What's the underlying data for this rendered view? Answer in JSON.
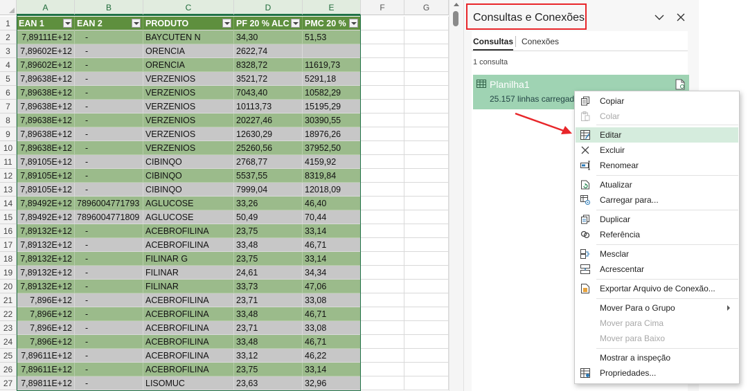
{
  "sheet": {
    "columns": [
      "A",
      "B",
      "C",
      "D",
      "E",
      "F",
      "G"
    ],
    "table_headers": [
      "EAN 1",
      "EAN 2",
      "PRODUTO",
      "PF 20 %  ALC",
      "PMC 20 %"
    ],
    "rows": [
      {
        "n": "2",
        "a": "7,89111E+12",
        "b": "-",
        "c": "BAYCUTEN N",
        "d": "34,30",
        "e": "51,53"
      },
      {
        "n": "3",
        "a": "7,89602E+12",
        "b": "-",
        "c": "ORENCIA",
        "d": "2622,74",
        "e": ""
      },
      {
        "n": "4",
        "a": "7,89602E+12",
        "b": "-",
        "c": "ORENCIA",
        "d": "8328,72",
        "e": "11619,73"
      },
      {
        "n": "5",
        "a": "7,89638E+12",
        "b": "-",
        "c": "VERZENIOS",
        "d": "3521,72",
        "e": "5291,18"
      },
      {
        "n": "6",
        "a": "7,89638E+12",
        "b": "-",
        "c": "VERZENIOS",
        "d": "7043,40",
        "e": "10582,29"
      },
      {
        "n": "7",
        "a": "7,89638E+12",
        "b": "-",
        "c": "VERZENIOS",
        "d": "10113,73",
        "e": "15195,29"
      },
      {
        "n": "8",
        "a": "7,89638E+12",
        "b": "-",
        "c": "VERZENIOS",
        "d": "20227,46",
        "e": "30390,55"
      },
      {
        "n": "9",
        "a": "7,89638E+12",
        "b": "-",
        "c": "VERZENIOS",
        "d": "12630,29",
        "e": "18976,26"
      },
      {
        "n": "10",
        "a": "7,89638E+12",
        "b": "-",
        "c": "VERZENIOS",
        "d": "25260,56",
        "e": "37952,50"
      },
      {
        "n": "11",
        "a": "7,89105E+12",
        "b": "-",
        "c": "CIBINQO",
        "d": "2768,77",
        "e": "4159,92"
      },
      {
        "n": "12",
        "a": "7,89105E+12",
        "b": "-",
        "c": "CIBINQO",
        "d": "5537,55",
        "e": "8319,84"
      },
      {
        "n": "13",
        "a": "7,89105E+12",
        "b": "-",
        "c": "CIBINQO",
        "d": "7999,04",
        "e": "12018,09"
      },
      {
        "n": "14",
        "a": "7,89492E+12",
        "b": "7896004771793",
        "c": "AGLUCOSE",
        "d": "33,26",
        "e": "46,40"
      },
      {
        "n": "15",
        "a": "7,89492E+12",
        "b": "7896004771809",
        "c": "AGLUCOSE",
        "d": "50,49",
        "e": "70,44"
      },
      {
        "n": "16",
        "a": "7,89132E+12",
        "b": "-",
        "c": "ACEBROFILINA",
        "d": "23,75",
        "e": "33,14"
      },
      {
        "n": "17",
        "a": "7,89132E+12",
        "b": "-",
        "c": "ACEBROFILINA",
        "d": "33,48",
        "e": "46,71"
      },
      {
        "n": "18",
        "a": "7,89132E+12",
        "b": "-",
        "c": "FILINAR G",
        "d": "23,75",
        "e": "33,14"
      },
      {
        "n": "19",
        "a": "7,89132E+12",
        "b": "-",
        "c": "FILINAR",
        "d": "24,61",
        "e": "34,34"
      },
      {
        "n": "20",
        "a": "7,89132E+12",
        "b": "-",
        "c": "FILINAR",
        "d": "33,73",
        "e": "47,06"
      },
      {
        "n": "21",
        "a": "7,896E+12",
        "b": "-",
        "c": "ACEBROFILINA",
        "d": "23,71",
        "e": "33,08"
      },
      {
        "n": "22",
        "a": "7,896E+12",
        "b": "-",
        "c": "ACEBROFILINA",
        "d": "33,48",
        "e": "46,71"
      },
      {
        "n": "23",
        "a": "7,896E+12",
        "b": "-",
        "c": "ACEBROFILINA",
        "d": "23,71",
        "e": "33,08"
      },
      {
        "n": "24",
        "a": "7,896E+12",
        "b": "-",
        "c": "ACEBROFILINA",
        "d": "33,48",
        "e": "46,71"
      },
      {
        "n": "25",
        "a": "7,89611E+12",
        "b": "-",
        "c": "ACEBROFILINA",
        "d": "33,12",
        "e": "46,22"
      },
      {
        "n": "26",
        "a": "7,89611E+12",
        "b": "-",
        "c": "ACEBROFILINA",
        "d": "23,75",
        "e": "33,14"
      },
      {
        "n": "27",
        "a": "7,89811E+12",
        "b": "-",
        "c": "LISOMUC",
        "d": "23,63",
        "e": "32,96"
      }
    ],
    "header_row_number": "1"
  },
  "panel": {
    "title": "Consultas e Conexões",
    "tabs": [
      "Consultas",
      "Conexões"
    ],
    "query_count": "1 consulta",
    "query": {
      "name": "Planilha1",
      "status": "25.157 linhas carregad"
    }
  },
  "context_menu": {
    "items": [
      {
        "label": "Copiar",
        "icon": "copy-icon",
        "disabled": false
      },
      {
        "label": "Colar",
        "icon": "paste-icon",
        "disabled": true
      },
      {
        "label": "Editar",
        "icon": "edit-icon",
        "disabled": false,
        "highlighted": true
      },
      {
        "label": "Excluir",
        "icon": "delete-icon",
        "disabled": false
      },
      {
        "label": "Renomear",
        "icon": "rename-icon",
        "disabled": false
      },
      {
        "label": "Atualizar",
        "icon": "refresh-icon",
        "disabled": false
      },
      {
        "label": "Carregar para...",
        "icon": "load-to-icon",
        "disabled": false
      },
      {
        "label": "Duplicar",
        "icon": "duplicate-icon",
        "disabled": false
      },
      {
        "label": "Referência",
        "icon": "reference-icon",
        "disabled": false
      },
      {
        "label": "Mesclar",
        "icon": "merge-icon",
        "disabled": false
      },
      {
        "label": "Acrescentar",
        "icon": "append-icon",
        "disabled": false
      },
      {
        "label": "Exportar Arquivo de Conexão...",
        "icon": "export-connection-icon",
        "disabled": false
      },
      {
        "label": "Mover Para o Grupo",
        "icon": "",
        "disabled": false,
        "submenu": true
      },
      {
        "label": "Mover para Cima",
        "icon": "",
        "disabled": true
      },
      {
        "label": "Mover para Baixo",
        "icon": "",
        "disabled": true
      },
      {
        "label": "Mostrar a inspeção",
        "icon": "",
        "disabled": false
      },
      {
        "label": "Propriedades...",
        "icon": "properties-icon",
        "disabled": false
      }
    ]
  },
  "colors": {
    "table_header": "#5e8f3e",
    "row_green": "#9bbb8b",
    "row_gray": "#c7c7c7",
    "query_item": "#9fd3b3",
    "annotation_red": "#e8262a",
    "menu_highlight": "#d5ecdd"
  }
}
